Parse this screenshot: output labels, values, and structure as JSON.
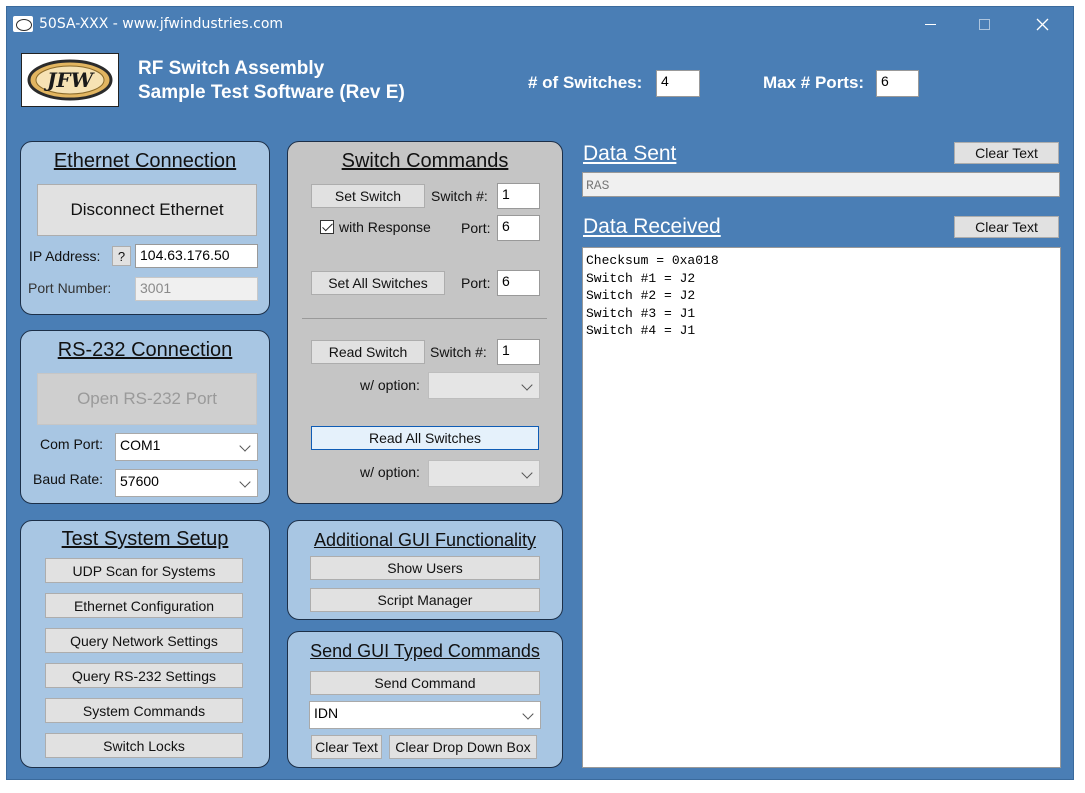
{
  "window": {
    "title": "50SA-XXX - www.jfwindustries.com"
  },
  "header": {
    "logo_text": "JFW",
    "title_line1": "RF Switch Assembly",
    "title_line2": "Sample Test Software (Rev E)",
    "num_switches_label": "# of Switches:",
    "num_switches_value": "4",
    "max_ports_label": "Max # Ports:",
    "max_ports_value": "6"
  },
  "ethernet": {
    "title": "Ethernet Connection",
    "disconnect_label": "Disconnect Ethernet",
    "ip_label": "IP Address:",
    "help_label": "?",
    "ip_value": "104.63.176.50",
    "port_label": "Port Number:",
    "port_value": "3001"
  },
  "rs232": {
    "title": "RS-232 Connection",
    "open_label": "Open RS-232 Port",
    "com_label": "Com Port:",
    "com_value": "COM1",
    "baud_label": "Baud Rate:",
    "baud_value": "57600"
  },
  "setup": {
    "title": "Test System Setup",
    "buttons": [
      "UDP Scan for Systems",
      "Ethernet Configuration",
      "Query Network Settings",
      "Query RS-232 Settings",
      "System Commands",
      "Switch Locks"
    ]
  },
  "switch_commands": {
    "title": "Switch Commands",
    "set_switch_label": "Set Switch",
    "switch_num_label": "Switch #:",
    "set_switch_num": "1",
    "with_response_label": "with Response",
    "port_label": "Port:",
    "set_port": "6",
    "set_all_label": "Set All Switches",
    "set_all_port": "6",
    "read_switch_label": "Read Switch",
    "read_switch_num": "1",
    "option_label": "w/ option:",
    "read_all_label": "Read All Switches"
  },
  "additional": {
    "title": "Additional GUI Functionality",
    "show_users_label": "Show Users",
    "script_manager_label": "Script Manager"
  },
  "typed": {
    "title": "Send GUI Typed Commands",
    "send_label": "Send Command",
    "command_value": "IDN",
    "clear_text_label": "Clear Text",
    "clear_dropdown_label": "Clear Drop Down Box"
  },
  "data_sent": {
    "title": "Data Sent",
    "clear_label": "Clear Text",
    "value": "RAS"
  },
  "data_received": {
    "title": "Data Received",
    "clear_label": "Clear Text",
    "lines": "Checksum = 0xa018\nSwitch #1 = J2\nSwitch #2 = J2\nSwitch #3 = J1\nSwitch #4 = J1"
  }
}
